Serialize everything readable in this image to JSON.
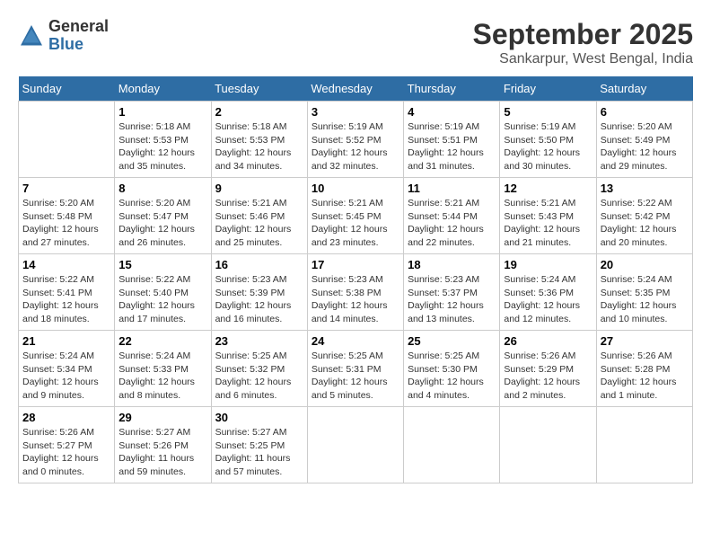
{
  "header": {
    "logo_general": "General",
    "logo_blue": "Blue",
    "month_year": "September 2025",
    "location": "Sankarpur, West Bengal, India"
  },
  "weekdays": [
    "Sunday",
    "Monday",
    "Tuesday",
    "Wednesday",
    "Thursday",
    "Friday",
    "Saturday"
  ],
  "weeks": [
    [
      {
        "day": "",
        "text": ""
      },
      {
        "day": "1",
        "text": "Sunrise: 5:18 AM\nSunset: 5:53 PM\nDaylight: 12 hours\nand 35 minutes."
      },
      {
        "day": "2",
        "text": "Sunrise: 5:18 AM\nSunset: 5:53 PM\nDaylight: 12 hours\nand 34 minutes."
      },
      {
        "day": "3",
        "text": "Sunrise: 5:19 AM\nSunset: 5:52 PM\nDaylight: 12 hours\nand 32 minutes."
      },
      {
        "day": "4",
        "text": "Sunrise: 5:19 AM\nSunset: 5:51 PM\nDaylight: 12 hours\nand 31 minutes."
      },
      {
        "day": "5",
        "text": "Sunrise: 5:19 AM\nSunset: 5:50 PM\nDaylight: 12 hours\nand 30 minutes."
      },
      {
        "day": "6",
        "text": "Sunrise: 5:20 AM\nSunset: 5:49 PM\nDaylight: 12 hours\nand 29 minutes."
      }
    ],
    [
      {
        "day": "7",
        "text": "Sunrise: 5:20 AM\nSunset: 5:48 PM\nDaylight: 12 hours\nand 27 minutes."
      },
      {
        "day": "8",
        "text": "Sunrise: 5:20 AM\nSunset: 5:47 PM\nDaylight: 12 hours\nand 26 minutes."
      },
      {
        "day": "9",
        "text": "Sunrise: 5:21 AM\nSunset: 5:46 PM\nDaylight: 12 hours\nand 25 minutes."
      },
      {
        "day": "10",
        "text": "Sunrise: 5:21 AM\nSunset: 5:45 PM\nDaylight: 12 hours\nand 23 minutes."
      },
      {
        "day": "11",
        "text": "Sunrise: 5:21 AM\nSunset: 5:44 PM\nDaylight: 12 hours\nand 22 minutes."
      },
      {
        "day": "12",
        "text": "Sunrise: 5:21 AM\nSunset: 5:43 PM\nDaylight: 12 hours\nand 21 minutes."
      },
      {
        "day": "13",
        "text": "Sunrise: 5:22 AM\nSunset: 5:42 PM\nDaylight: 12 hours\nand 20 minutes."
      }
    ],
    [
      {
        "day": "14",
        "text": "Sunrise: 5:22 AM\nSunset: 5:41 PM\nDaylight: 12 hours\nand 18 minutes."
      },
      {
        "day": "15",
        "text": "Sunrise: 5:22 AM\nSunset: 5:40 PM\nDaylight: 12 hours\nand 17 minutes."
      },
      {
        "day": "16",
        "text": "Sunrise: 5:23 AM\nSunset: 5:39 PM\nDaylight: 12 hours\nand 16 minutes."
      },
      {
        "day": "17",
        "text": "Sunrise: 5:23 AM\nSunset: 5:38 PM\nDaylight: 12 hours\nand 14 minutes."
      },
      {
        "day": "18",
        "text": "Sunrise: 5:23 AM\nSunset: 5:37 PM\nDaylight: 12 hours\nand 13 minutes."
      },
      {
        "day": "19",
        "text": "Sunrise: 5:24 AM\nSunset: 5:36 PM\nDaylight: 12 hours\nand 12 minutes."
      },
      {
        "day": "20",
        "text": "Sunrise: 5:24 AM\nSunset: 5:35 PM\nDaylight: 12 hours\nand 10 minutes."
      }
    ],
    [
      {
        "day": "21",
        "text": "Sunrise: 5:24 AM\nSunset: 5:34 PM\nDaylight: 12 hours\nand 9 minutes."
      },
      {
        "day": "22",
        "text": "Sunrise: 5:24 AM\nSunset: 5:33 PM\nDaylight: 12 hours\nand 8 minutes."
      },
      {
        "day": "23",
        "text": "Sunrise: 5:25 AM\nSunset: 5:32 PM\nDaylight: 12 hours\nand 6 minutes."
      },
      {
        "day": "24",
        "text": "Sunrise: 5:25 AM\nSunset: 5:31 PM\nDaylight: 12 hours\nand 5 minutes."
      },
      {
        "day": "25",
        "text": "Sunrise: 5:25 AM\nSunset: 5:30 PM\nDaylight: 12 hours\nand 4 minutes."
      },
      {
        "day": "26",
        "text": "Sunrise: 5:26 AM\nSunset: 5:29 PM\nDaylight: 12 hours\nand 2 minutes."
      },
      {
        "day": "27",
        "text": "Sunrise: 5:26 AM\nSunset: 5:28 PM\nDaylight: 12 hours\nand 1 minute."
      }
    ],
    [
      {
        "day": "28",
        "text": "Sunrise: 5:26 AM\nSunset: 5:27 PM\nDaylight: 12 hours\nand 0 minutes."
      },
      {
        "day": "29",
        "text": "Sunrise: 5:27 AM\nSunset: 5:26 PM\nDaylight: 11 hours\nand 59 minutes."
      },
      {
        "day": "30",
        "text": "Sunrise: 5:27 AM\nSunset: 5:25 PM\nDaylight: 11 hours\nand 57 minutes."
      },
      {
        "day": "",
        "text": ""
      },
      {
        "day": "",
        "text": ""
      },
      {
        "day": "",
        "text": ""
      },
      {
        "day": "",
        "text": ""
      }
    ]
  ]
}
